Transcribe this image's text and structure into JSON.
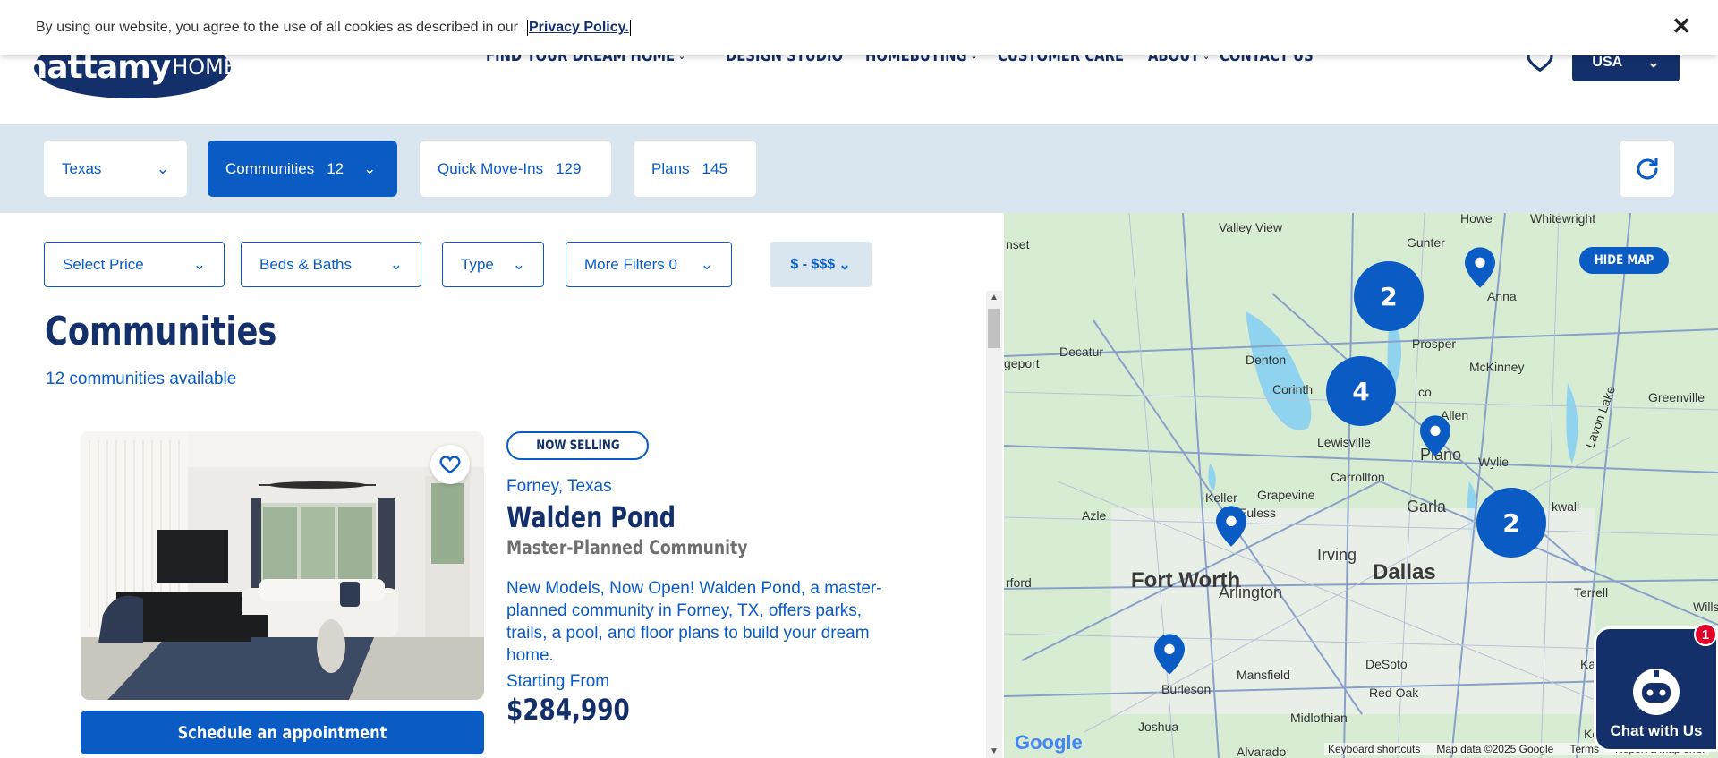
{
  "cookie_banner": {
    "text": "By using our website, you agree to the use of all cookies as described in our",
    "policy_link": "Privacy Policy.",
    "close": "✕"
  },
  "header": {
    "logo_main": "mattamy",
    "logo_sub": "HOMES",
    "nav": [
      {
        "label": "FIND YOUR DREAM HOME",
        "dropdown": true
      },
      {
        "label": "DESIGN STUDIO",
        "dropdown": false
      },
      {
        "label": "HOMEBUYING",
        "dropdown": true
      },
      {
        "label": "CUSTOMER CARE",
        "dropdown": false
      },
      {
        "label": "ABOUT",
        "dropdown": true
      },
      {
        "label": "CONTACT US",
        "dropdown": false
      }
    ],
    "country": "USA"
  },
  "filters": {
    "state": "Texas",
    "tabs": [
      {
        "label": "Communities",
        "count": "12"
      },
      {
        "label": "Quick Move-Ins",
        "count": "129"
      },
      {
        "label": "Plans",
        "count": "145"
      }
    ],
    "price": "Select Price",
    "beds_baths": "Beds & Baths",
    "type": "Type",
    "more_filters": "More Filters 0",
    "price_range": "$ - $$$"
  },
  "listing": {
    "heading": "Communities",
    "count_text": "12 communities available",
    "card": {
      "badge": "NOW SELLING",
      "location": "Forney, Texas",
      "name": "Walden Pond",
      "type": "Master-Planned Community",
      "description": "New Models, Now Open! Walden Pond, a master-planned community in Forney, TX, offers parks, trails, a pool, and floor plans to build your dream home.",
      "starting_label": "Starting From",
      "price": "$284,990",
      "cta": "Schedule an appointment"
    }
  },
  "map": {
    "hide_label": "HIDE MAP",
    "clusters": [
      "2",
      "4",
      "2"
    ],
    "labels": {
      "howe": "Howe",
      "whitewright": "Whitewright",
      "valley_view": "Valley View",
      "gunter": "Gunter",
      "anna": "Anna",
      "sunset": "nset",
      "prosper": "Prosper",
      "decatur": "Decatur",
      "denton": "Denton",
      "mckinney": "McKinney",
      "bridgeport": "geport",
      "corinth": "Corinth",
      "co": "co",
      "allen": "Allen",
      "greenville": "Greenville",
      "lewisville": "Lewisville",
      "plano": "Plano",
      "wylie": "Wylie",
      "lavon_lake": "Lavon Lake",
      "carrollton": "Carrollton",
      "keller": "Keller",
      "grapevine": "Grapevine",
      "garland": "Garla",
      "rockwall": "kwall",
      "azle": "Azle",
      "euless": "Euless",
      "irving": "Irving",
      "dallas": "Dallas",
      "fort_worth": "Fort Worth",
      "arlington": "Arlington",
      "weatherford": "rford",
      "terrell": "Terrell",
      "wills": "Wills",
      "mansfield": "Mansfield",
      "desoto": "DeSoto",
      "burleson": "Burleson",
      "red_oak": "Red Oak",
      "midlothian": "Midlothian",
      "kaufman": "Kau",
      "joshua": "Joshua",
      "alvarado": "Alvarado",
      "kemp": "Kemp"
    },
    "footer": [
      "Keyboard shortcuts",
      "Map data ©2025 Google",
      "Terms",
      "Report a map error"
    ],
    "google": "Google"
  },
  "chat": {
    "label": "Chat with Us",
    "badge": "1"
  },
  "colors": {
    "brand_navy": "#13306b",
    "brand_blue": "#0a5bc4",
    "band_bg": "#dae6ef"
  }
}
